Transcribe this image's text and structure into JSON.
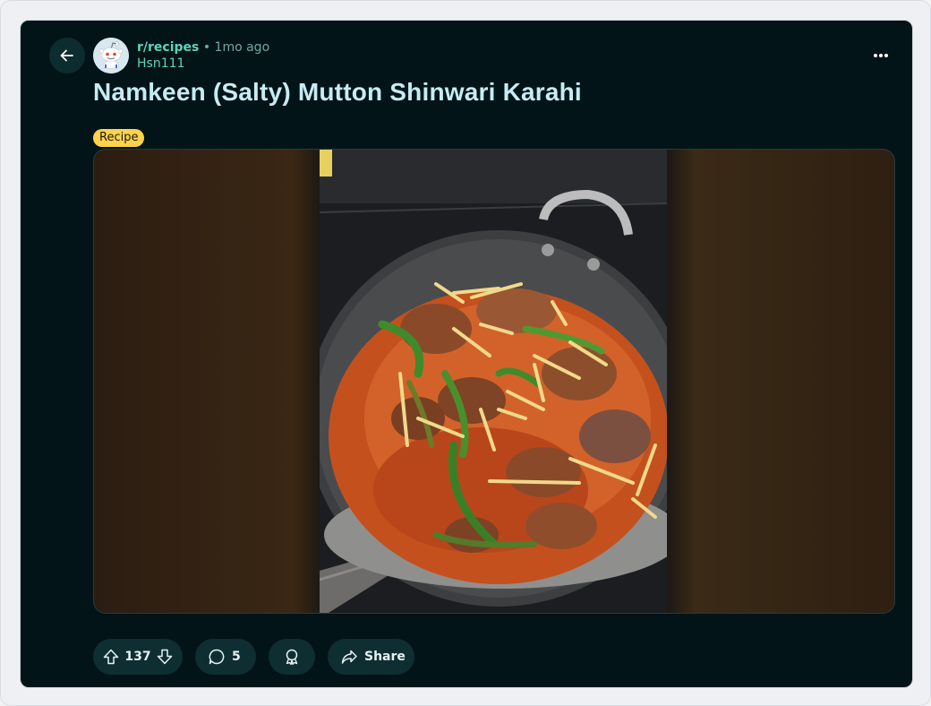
{
  "post": {
    "subreddit": "r/recipes",
    "separator": "•",
    "time_ago": "1mo ago",
    "author": "Hsn111",
    "title": "Namkeen (Salty) Mutton Shinwari Karahi",
    "flair": "Recipe"
  },
  "actions": {
    "vote_count": "137",
    "comment_count": "5",
    "share_label": "Share"
  },
  "icons": {
    "back": "arrow-left-icon",
    "avatar": "reddit-snoo-avatar-icon",
    "more": "ellipsis-icon",
    "upvote": "arrow-up-icon",
    "downvote": "arrow-down-icon",
    "comment": "comment-bubble-icon",
    "award": "award-icon",
    "share": "share-arrow-icon"
  },
  "colors": {
    "card_background": "#021417",
    "accent_teal": "#5fd3bc",
    "title": "#c6ecf3",
    "flair": "#ffd24c",
    "pill": "#0f2e31"
  }
}
